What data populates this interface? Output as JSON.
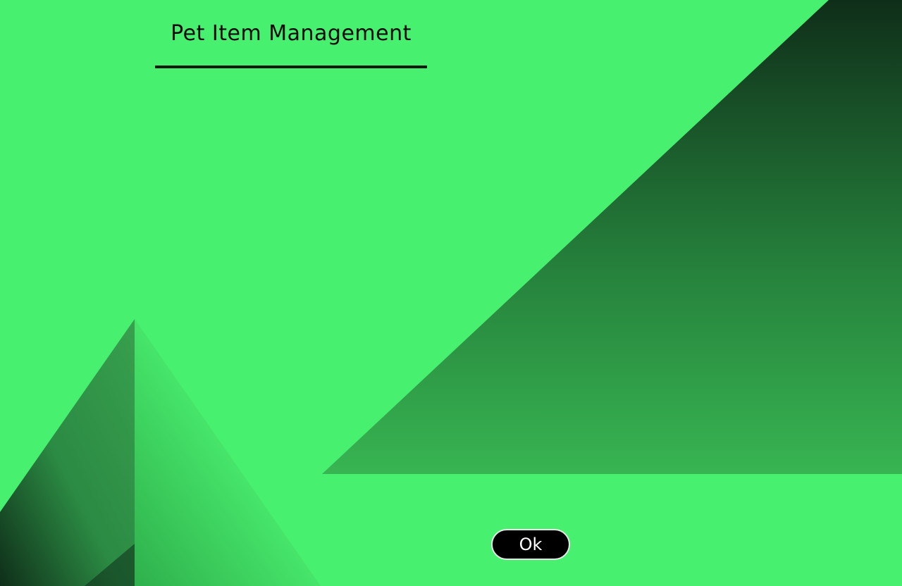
{
  "dialog": {
    "title": "Pet Item Management",
    "ok_label": "Ok"
  },
  "colors": {
    "background": "#47f06e",
    "decor_dark": "#0f2e19",
    "decor_light": "#38b552",
    "button_bg": "#000000",
    "button_text": "#ffffff",
    "title_text": "#0a0a0a"
  }
}
